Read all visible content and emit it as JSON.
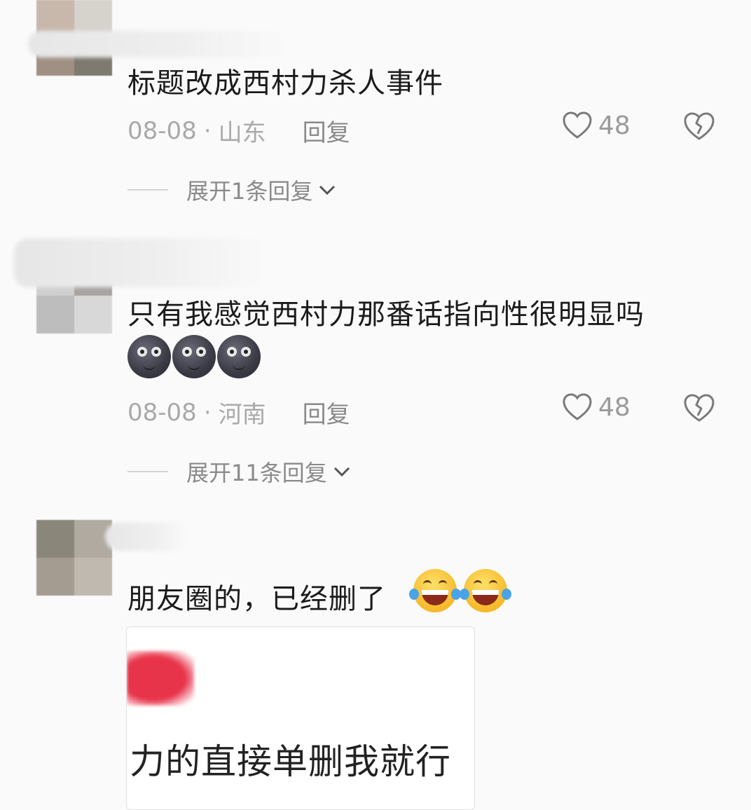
{
  "comments": [
    {
      "text": "标题改成西村力杀人事件",
      "date": "08-08",
      "location": "山东",
      "reply_label": "回复",
      "likes": "48",
      "expand_label": "展开1条回复"
    },
    {
      "text": "只有我感觉西村力那番话指向性很明显吗",
      "emoji": [
        "new-moon-face-emoji",
        "new-moon-face-emoji",
        "new-moon-face-emoji"
      ],
      "date": "08-08",
      "location": "河南",
      "reply_label": "回复",
      "likes": "48",
      "expand_label": "展开11条回复"
    },
    {
      "text": "朋友圈的，已经删了",
      "emoji": [
        "tears-of-joy-emoji",
        "tears-of-joy-emoji"
      ],
      "image_card_text": "力的直接单删我就行"
    }
  ],
  "meta_separator": "·",
  "colors": {
    "accent_red": "#e8344a",
    "meta_gray": "#a9a9a9"
  }
}
